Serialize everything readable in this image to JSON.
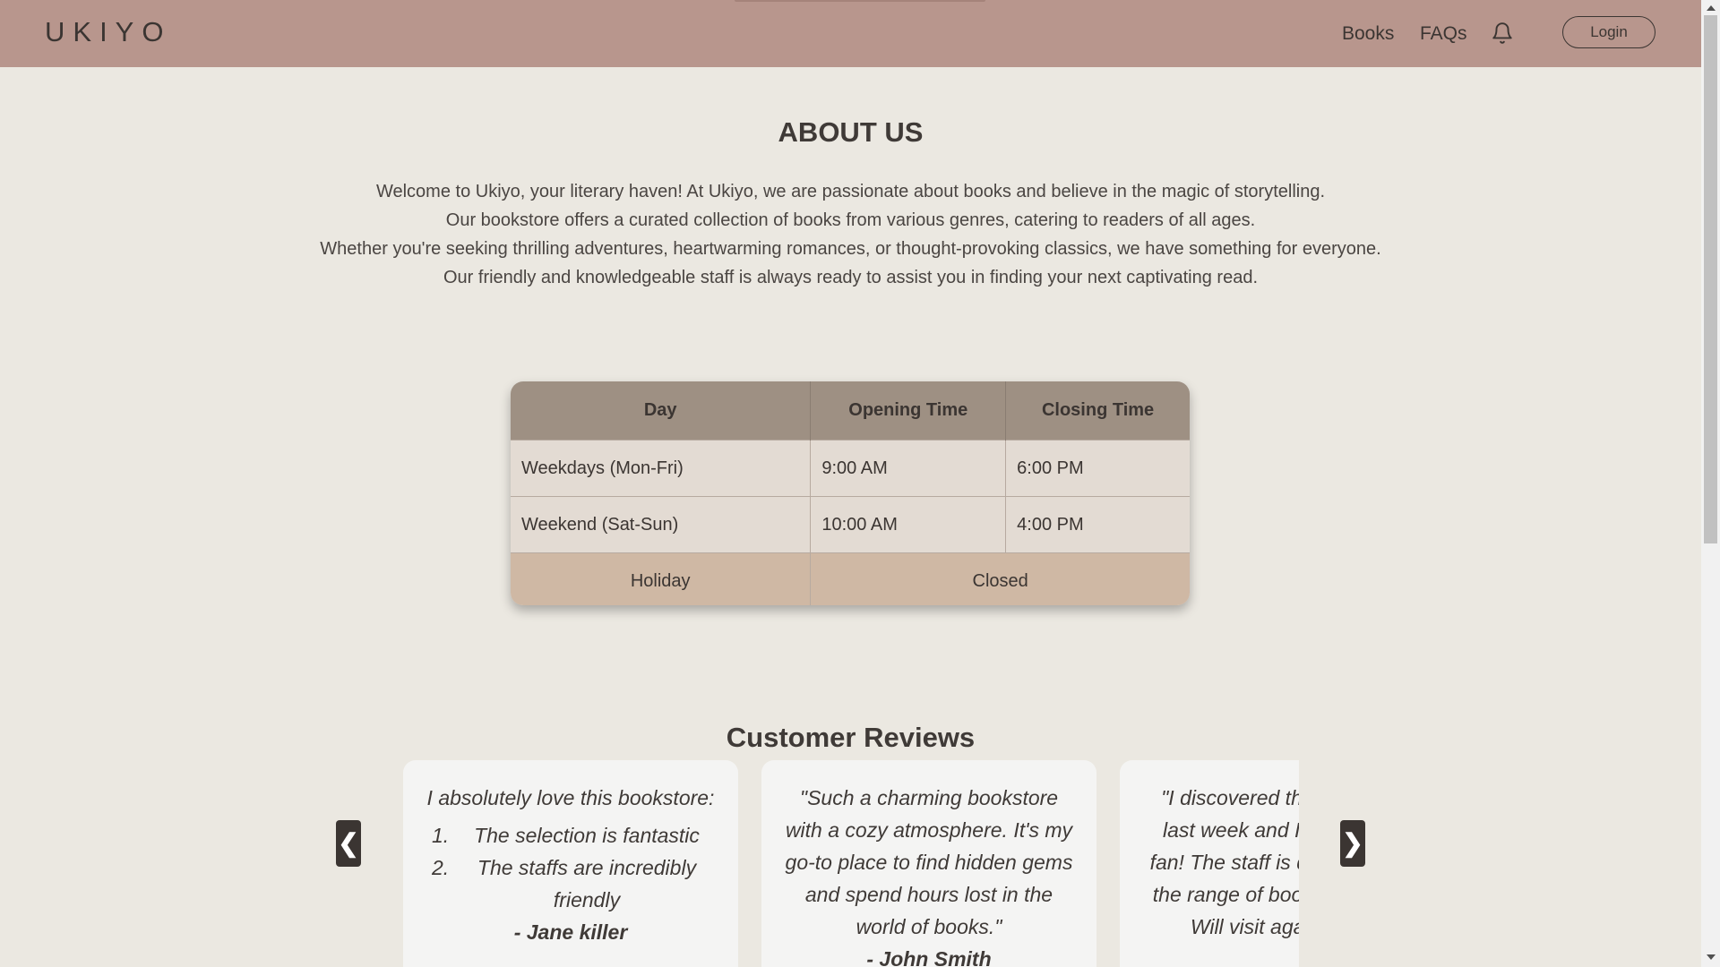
{
  "navbar": {
    "logo": "UKIYO",
    "links": [
      "Books",
      "FAQs"
    ],
    "login_label": "Login"
  },
  "about": {
    "title": "ABOUT US",
    "lines": [
      "Welcome to Ukiyo, your literary haven! At Ukiyo, we are passionate about books and believe in the magic of storytelling.",
      "Our bookstore offers a curated collection of books from various genres, catering to readers of all ages.",
      "Whether you're seeking thrilling adventures, heartwarming romances, or thought-provoking classics, we have something for everyone.",
      "Our friendly and knowledgeable staff is always ready to assist you in finding your next captivating read."
    ]
  },
  "hours": {
    "headers": [
      "Day",
      "Opening Time",
      "Closing Time"
    ],
    "rows": [
      [
        "Weekdays (Mon-Fri)",
        "9:00 AM",
        "6:00 PM"
      ],
      [
        "Weekend (Sat-Sun)",
        "10:00 AM",
        "4:00 PM"
      ]
    ],
    "holiday": {
      "day": "Holiday",
      "status": "Closed"
    }
  },
  "reviews": {
    "title": "Customer Reviews",
    "prev_label": "❮",
    "next_label": "❯",
    "items": [
      {
        "intro": "I absolutely love this bookstore:",
        "list": [
          "The selection is fantastic",
          "The staffs are incredibly friendly"
        ],
        "author": "- Jane killer"
      },
      {
        "text": "\"Such a charming bookstore with a cozy atmosphere. It's my go-to place to find hidden gems and spend hours lost in the world of books.\"",
        "author": "- John Smith"
      },
      {
        "text": "\"I discovered this bookstore last week and I'm already a fan! The staff is delightful, and the range of books is diverse. Will visit again soon!\"",
        "author": ""
      }
    ]
  },
  "colors": {
    "navbar": "#b8968d",
    "background": "#ebe8e1",
    "table_header": "#9e9083",
    "table_row": "#e3dbd3",
    "holiday_row": "#cfb8a4",
    "card": "#f4f4f3",
    "arrow": "#3b3532"
  },
  "icons": {
    "bell": "bell-icon"
  }
}
